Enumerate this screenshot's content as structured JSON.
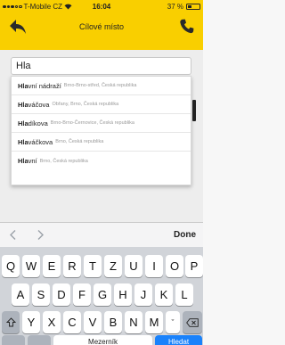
{
  "status_bar": {
    "carrier": "T-Mobile CZ",
    "time": "16:04",
    "battery_percent": "37 %",
    "battery_level": 0.37
  },
  "nav": {
    "title": "Cílové místo",
    "back_icon": "back-arrow-icon",
    "phone_icon": "phone-icon"
  },
  "search": {
    "value": "Hla"
  },
  "suggestions": [
    {
      "match": "Hla",
      "rest": "vní nádraží",
      "sub": "Brno-Brno-střed, Česká republika"
    },
    {
      "match": "Hla",
      "rest": "váčova",
      "sub": "Obřany, Brno, Česká republika"
    },
    {
      "match": "Hla",
      "rest": "díkova",
      "sub": "Brno-Brno-Černovice, Česká republika"
    },
    {
      "match": "Hla",
      "rest": "váčkova",
      "sub": "Brno, Česká republika"
    },
    {
      "match": "Hla",
      "rest": "vní",
      "sub": "Brno, Česká republika"
    }
  ],
  "accessory": {
    "done_label": "Done",
    "prev_icon": "chevron-left-icon",
    "next_icon": "chevron-right-icon"
  },
  "keyboard": {
    "row1": [
      "Q",
      "W",
      "E",
      "R",
      "T",
      "Z",
      "U",
      "I",
      "O",
      "P"
    ],
    "row2": [
      "A",
      "S",
      "D",
      "F",
      "G",
      "H",
      "J",
      "K",
      "L"
    ],
    "row3": [
      "Y",
      "X",
      "C",
      "V",
      "B",
      "N",
      "M",
      "ˇ"
    ],
    "space_label": "Mezerník",
    "return_label": "Hledat",
    "shift_icon": "shift-icon",
    "backspace_icon": "backspace-icon"
  },
  "colors": {
    "brand_yellow": "#f9cf00",
    "return_blue": "#1a82fb"
  }
}
